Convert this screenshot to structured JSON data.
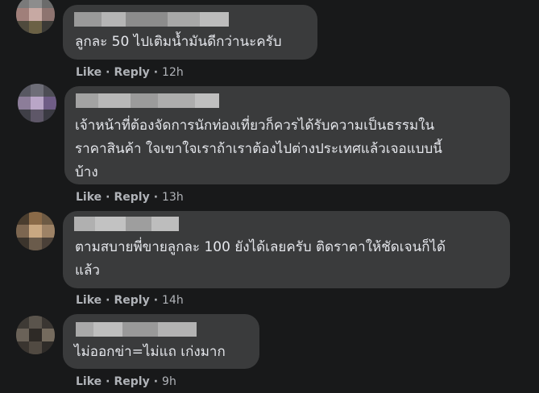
{
  "comments": [
    {
      "text": "ลูกละ 50 ไปเติมน้ำมันดีกว่านะครับ",
      "like_label": "Like",
      "reply_label": "Reply",
      "time": "12h"
    },
    {
      "text": "เจ้าหน้าที่ต้องจัดการนักท่องเที่ยวก็ควรได้รับความเป็นธรรมใน\nราคาสินค้า ใจเขาใจเราถ้าเราต้องไปต่างประเทศแล้วเจอแบบนี้\nบ้าง",
      "like_label": "Like",
      "reply_label": "Reply",
      "time": "13h"
    },
    {
      "text": "ตามสบายพี่ขายลูกละ 100 ยังได้เลยครับ ติดราคาให้ชัดเจนก็ได้\nแล้ว",
      "like_label": "Like",
      "reply_label": "Reply",
      "time": "14h"
    },
    {
      "text": "ไม่ออกข่า=ไม่แถ เก่งมาก",
      "like_label": "Like",
      "reply_label": "Reply",
      "time": "9h"
    }
  ],
  "separator": "·"
}
